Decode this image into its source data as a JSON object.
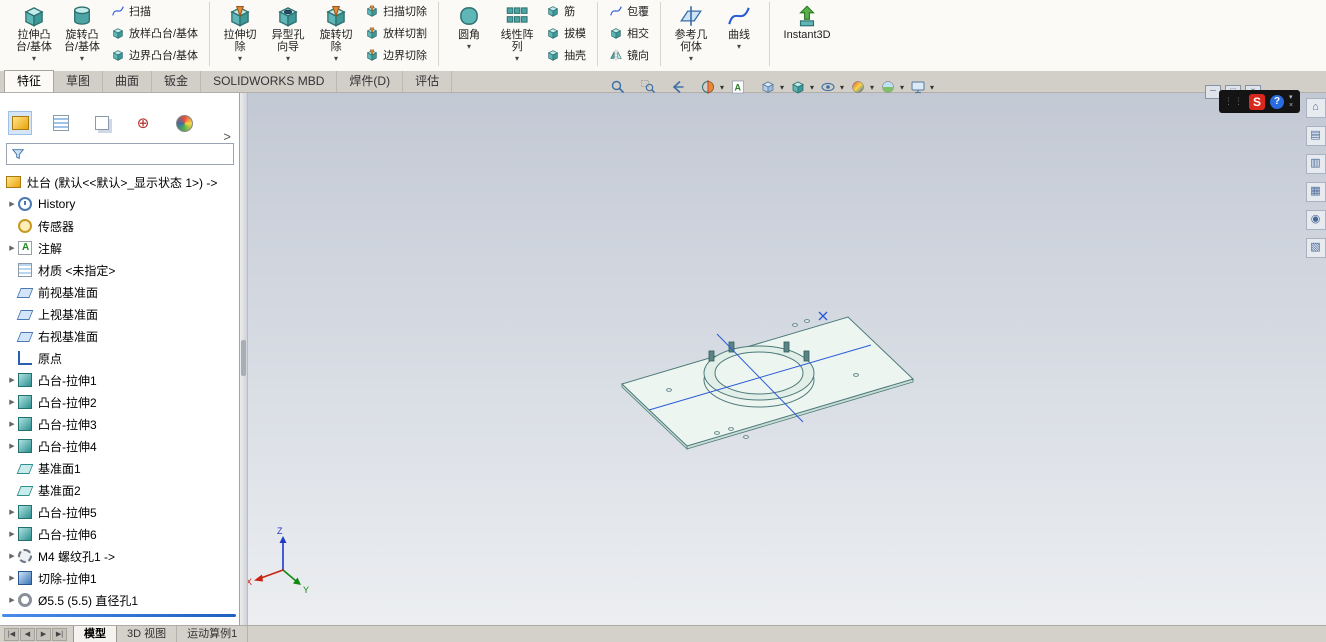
{
  "ribbon": {
    "groups": [
      {
        "big": [
          {
            "line1": "拉伸凸",
            "line2": "台/基体"
          },
          {
            "line1": "旋转凸",
            "line2": "台/基体"
          }
        ],
        "stack": [
          "扫描",
          "放样凸台/基体",
          "边界凸台/基体"
        ]
      },
      {
        "big": [
          {
            "line1": "拉伸切",
            "line2": "除"
          },
          {
            "line1": "异型孔",
            "line2": "向导"
          },
          {
            "line1": "旋转切",
            "line2": "除"
          }
        ],
        "stack": [
          "扫描切除",
          "放样切割",
          "边界切除"
        ]
      },
      {
        "big": [
          {
            "line1": "圆角",
            "line2": ""
          },
          {
            "line1": "线性阵",
            "line2": "列"
          }
        ],
        "stack": [
          "筋",
          "拔模",
          "抽壳"
        ]
      },
      {
        "big": [],
        "stack": [
          "包覆",
          "相交",
          "镜向"
        ]
      },
      {
        "big": [
          {
            "line1": "参考几",
            "line2": "何体"
          },
          {
            "line1": "曲线",
            "line2": ""
          }
        ],
        "stack": []
      },
      {
        "big": [
          {
            "line1": "Instant3D",
            "line2": ""
          }
        ],
        "stack": []
      }
    ]
  },
  "command_tabs": {
    "items": [
      "特征",
      "草图",
      "曲面",
      "钣金",
      "SOLIDWORKS MBD",
      "焊件(D)",
      "评估"
    ],
    "active": "特征"
  },
  "hud": {
    "buttons": [
      {
        "name": "zoom-to-fit-button",
        "sym": "mag",
        "dropdown": false
      },
      {
        "name": "zoom-to-area-button",
        "sym": "magarea",
        "dropdown": false
      },
      {
        "name": "previous-view-button",
        "sym": "prev",
        "dropdown": false
      },
      {
        "name": "section-view-button",
        "sym": "sect",
        "dropdown": true
      },
      {
        "name": "dynamic-annotation-button",
        "sym": "anno",
        "dropdown": false
      },
      {
        "name": "view-orientation-button",
        "sym": "cube",
        "dropdown": true
      },
      {
        "name": "display-style-button",
        "sym": "boss",
        "dropdown": true
      },
      {
        "name": "hide-show-items-button",
        "sym": "eye",
        "dropdown": true
      },
      {
        "name": "edit-appearance-button",
        "sym": "ball",
        "dropdown": true
      },
      {
        "name": "apply-scene-button",
        "sym": "scene",
        "dropdown": true
      },
      {
        "name": "view-settings-button",
        "sym": "monitor",
        "dropdown": true
      }
    ]
  },
  "doc_controls": [
    {
      "name": "doc-minimize-button",
      "glyph": "─"
    },
    {
      "name": "doc-restore-button",
      "glyph": "□"
    },
    {
      "name": "doc-close-button",
      "glyph": "×"
    }
  ],
  "help_widget": {
    "logo": "S",
    "help": "?",
    "pin": "▾",
    "close": "×"
  },
  "task_pane": {
    "tabs": [
      {
        "name": "solidworks-resources-tab",
        "glyph": "⌂"
      },
      {
        "name": "design-library-tab",
        "glyph": "▤"
      },
      {
        "name": "file-explorer-tab",
        "glyph": "▥"
      },
      {
        "name": "view-palette-tab",
        "glyph": "▦"
      },
      {
        "name": "appearances-scenes-tab",
        "glyph": "◉"
      },
      {
        "name": "custom-properties-tab",
        "glyph": "▧"
      }
    ]
  },
  "feature_panel": {
    "filter_value": "",
    "root": {
      "label": "灶台 (默认<<默认>_显示状态 1>) ->",
      "icon": "part"
    },
    "items": [
      {
        "label": "History",
        "icon": "history",
        "expand": true
      },
      {
        "label": "传感器",
        "icon": "sensors",
        "expand": false
      },
      {
        "label": "注解",
        "icon": "annotations",
        "expand": true
      },
      {
        "label": "材质 <未指定>",
        "icon": "material",
        "expand": false
      },
      {
        "label": "前视基准面",
        "icon": "plane",
        "expand": false
      },
      {
        "label": "上视基准面",
        "icon": "plane",
        "expand": false
      },
      {
        "label": "右视基准面",
        "icon": "plane",
        "expand": false
      },
      {
        "label": "原点",
        "icon": "origin",
        "expand": false
      },
      {
        "label": "凸台-拉伸1",
        "icon": "boss-extrude",
        "expand": true
      },
      {
        "label": "凸台-拉伸2",
        "icon": "boss-extrude",
        "expand": true
      },
      {
        "label": "凸台-拉伸3",
        "icon": "boss-extrude",
        "expand": true
      },
      {
        "label": "凸台-拉伸4",
        "icon": "boss-extrude",
        "expand": true
      },
      {
        "label": "基准面1",
        "icon": "ref-plane",
        "expand": false
      },
      {
        "label": "基准面2",
        "icon": "ref-plane",
        "expand": false
      },
      {
        "label": "凸台-拉伸5",
        "icon": "boss-extrude",
        "expand": true
      },
      {
        "label": "凸台-拉伸6",
        "icon": "boss-extrude",
        "expand": true
      },
      {
        "label": "M4 螺纹孔1 ->",
        "icon": "thread-hole",
        "expand": true
      },
      {
        "label": "切除-拉伸1",
        "icon": "cut-extrude",
        "expand": true
      },
      {
        "label": "Ø5.5 (5.5) 直径孔1",
        "icon": "hole",
        "expand": true
      }
    ]
  },
  "viewport": {
    "triad": {
      "x": "X",
      "y": "Y",
      "z": "Z"
    }
  },
  "status_bar": {
    "nav": [
      "|◀",
      "◀",
      "▶",
      "▶|"
    ],
    "tabs": [
      "模型",
      "3D 视图",
      "运动算例1"
    ],
    "active": "模型"
  },
  "icons": {
    "dropdown_arrow": "▾",
    "expand_arrow": "▶",
    "collapse_arrow": ">",
    "filter_icon": "funnel"
  },
  "colors": {
    "accent_teal": "#2f8f8f",
    "plate_edge": "#4d7a78",
    "plate_fill": "#edf5f1",
    "centerline_blue": "#2b5bd7",
    "rollback_blue": "#2a6de0",
    "viewport_top": "#c3c9d4",
    "viewport_bottom": "#eceef1",
    "logo_red": "#d8281e",
    "help_blue": "#2a6de0"
  }
}
